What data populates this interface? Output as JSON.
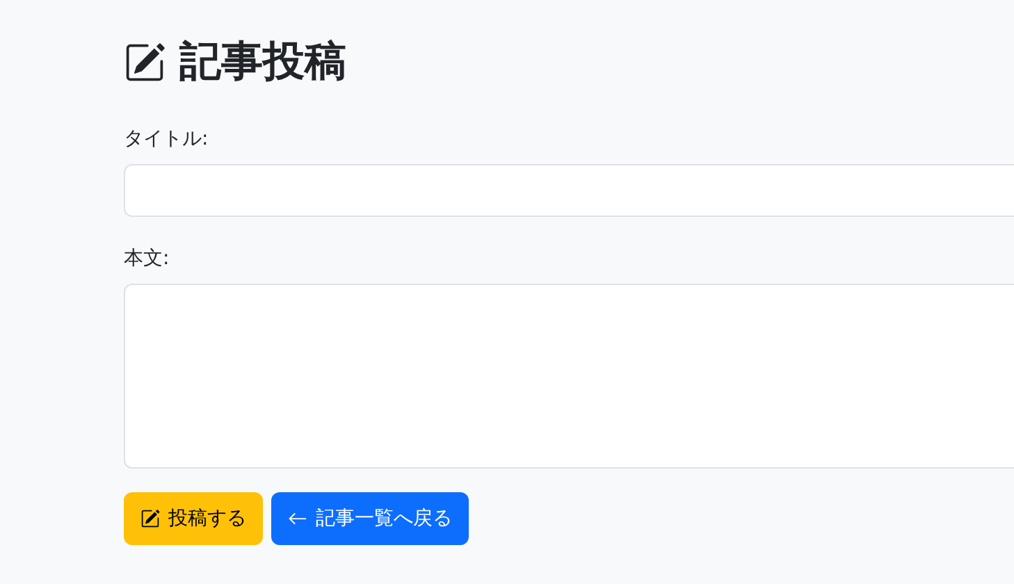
{
  "heading": {
    "title": "記事投稿"
  },
  "fields": [
    {
      "kind": "input",
      "label": "タイトル:"
    },
    {
      "kind": "textarea",
      "label": "本文:"
    }
  ],
  "buttons": [
    {
      "kind": "submit",
      "label": "投稿する"
    },
    {
      "kind": "back",
      "label": "記事一覧へ戻る"
    }
  ]
}
